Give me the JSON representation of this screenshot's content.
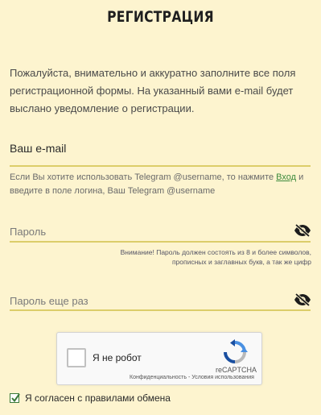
{
  "header": {
    "title": "РЕГИСТРАЦИЯ"
  },
  "intro": {
    "text": "Пожалуйста, внимательно и аккуратно заполните все поля регистрационной формы. На указанный вами e-mail будет выслано уведомление о регистрации."
  },
  "email": {
    "label": "Ваш e-mail",
    "hint_before": "Если Вы хотите использовать Telegram @username, то нажмите ",
    "hint_link": "Вход",
    "hint_after": " и введите в поле логина, Ваш Telegram @username"
  },
  "password": {
    "placeholder": "Пароль",
    "warning": "Внимание! Пароль должен состоять из 8 и более символов, прописных и заглавных букв, а так же цифр"
  },
  "password_repeat": {
    "placeholder": "Пароль еще раз"
  },
  "captcha": {
    "label": "Я не робот",
    "brand": "reCAPTCHA",
    "legal": "Конфиденциальность - Условия использования"
  },
  "agreement": {
    "label": "Я согласен с правилами обмена",
    "checked": true
  },
  "colors": {
    "background": "#fdf4cf",
    "underline": "#dccd6a",
    "link": "#3c8a3c"
  }
}
